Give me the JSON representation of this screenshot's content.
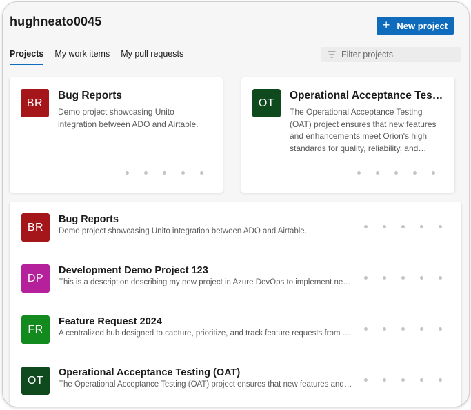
{
  "header": {
    "org_name": "hughneato0045",
    "new_project_label": "New project",
    "accent_color": "#0f6cbd"
  },
  "tabs": [
    {
      "label": "Projects",
      "active": true
    },
    {
      "label": "My work items",
      "active": false
    },
    {
      "label": "My pull requests",
      "active": false
    }
  ],
  "filter": {
    "placeholder": "Filter projects",
    "value": "",
    "icon": "filter-icon"
  },
  "recent_cards": [
    {
      "initials": "BR",
      "color": "#a4161a",
      "title": "Bug Reports",
      "description": "Demo project showcasing Unito integration between ADO and Airtable."
    },
    {
      "initials": "OT",
      "color": "#0e4a1e",
      "title": "Operational Acceptance Testing (OAT)",
      "description": "The Operational Acceptance Testing (OAT) project ensures that new features and enhancements meet Orion's high standards for quality, reliability, and performance."
    }
  ],
  "projects": [
    {
      "initials": "BR",
      "color": "#a4161a",
      "title": "Bug Reports",
      "description": "Demo project showcasing Unito integration between ADO and Airtable."
    },
    {
      "initials": "DP",
      "color": "#b4219a",
      "title": "Development Demo Project 123",
      "description": "This is a description describing my new project in Azure DevOps to implement new features."
    },
    {
      "initials": "FR",
      "color": "#138a1e",
      "title": "Feature Request 2024",
      "description": "A centralized hub designed to capture, prioritize, and track feature requests from users."
    },
    {
      "initials": "OT",
      "color": "#0e4a1e",
      "title": "Operational Acceptance Testing (OAT)",
      "description": "The Operational Acceptance Testing (OAT) project ensures that new features and enhancements meet Orion's high standards."
    }
  ]
}
